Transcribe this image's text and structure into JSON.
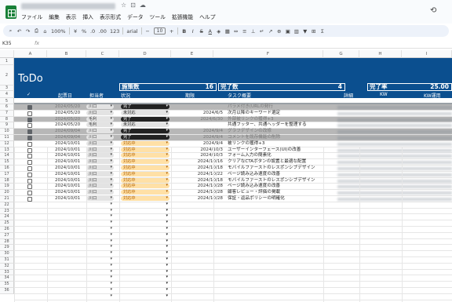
{
  "menu": [
    "ファイル",
    "編集",
    "表示",
    "挿入",
    "表示形式",
    "データ",
    "ツール",
    "拡張機能",
    "ヘルプ"
  ],
  "toolbar": {
    "zoom": "100%",
    "currency": "¥",
    "percent": "%",
    "dec_dec": ".0",
    "dec_inc": ".00",
    "number_format": "123",
    "font": "arial",
    "font_size": "10",
    "bold": "B",
    "italic": "I",
    "strike": "S",
    "text_color": "A"
  },
  "fxbar": {
    "cell_ref": "K35",
    "fx": "fx"
  },
  "columns": [
    "A",
    "B",
    "C",
    "D",
    "E",
    "F",
    "G",
    "H",
    "I"
  ],
  "rows": [
    "1",
    "2",
    "3",
    "4",
    "5",
    "6",
    "7",
    "8",
    "9",
    "10",
    "11",
    "12",
    "13",
    "14",
    "15",
    "16",
    "17",
    "18",
    "19",
    "20",
    "21",
    "22",
    "23",
    "24",
    "25",
    "26",
    "27",
    "28",
    "29",
    "30",
    "31",
    "32",
    "33",
    "34",
    "35",
    "36"
  ],
  "banner": {
    "title": "ToDo",
    "stats": [
      {
        "label": "施策数",
        "value": "16"
      },
      {
        "label": "完了数",
        "value": "4"
      },
      {
        "label": "完了率",
        "value": "25.00"
      }
    ]
  },
  "header": {
    "check": "✓",
    "date": "起票日",
    "person": "担当者",
    "status": "状況",
    "deadline": "期限",
    "summary": "タスク概要",
    "detail": "詳細",
    "kw": "KW",
    "kw_use": "KW運用"
  },
  "tasks": [
    {
      "checked": true,
      "date": "2024/05/20",
      "person": "川口",
      "status": "完了",
      "deadline": "",
      "summary": "パラメ付き(URLの発行"
    },
    {
      "checked": false,
      "date": "2024/05/20",
      "person": "川口",
      "status": "未対応",
      "deadline": "2024/6/5",
      "summary": "次月以降のキーワード選定"
    },
    {
      "checked": true,
      "date": "2024/05/20",
      "person": "毛利",
      "status": "完了",
      "deadline": "2024/6/30",
      "summary": "外部被リンクの獲得+3"
    },
    {
      "checked": false,
      "date": "2024/05/20",
      "person": "毛利",
      "status": "未対応",
      "deadline": "",
      "summary": "共通フッター、共通ヘッダーを整理する"
    },
    {
      "checked": true,
      "date": "2024/09/04",
      "person": "川口",
      "status": "完了",
      "deadline": "2024/9/4",
      "summary": "グラフデザインの改修"
    },
    {
      "checked": true,
      "date": "2024/09/04",
      "person": "川口",
      "status": "完了",
      "deadline": "2024/9/4",
      "summary": "コメントを既存機能の削除"
    },
    {
      "checked": false,
      "date": "2024/10/01",
      "person": "川口",
      "status": "対応中",
      "deadline": "2024/9/4",
      "summary": "被リンクの獲得+3"
    },
    {
      "checked": false,
      "date": "2024/10/01",
      "person": "川口",
      "status": "対応中",
      "deadline": "2024/10/3",
      "summary": "ユーザーインターフェース(UI)の改善"
    },
    {
      "checked": false,
      "date": "2024/10/01",
      "person": "川口",
      "status": "対応中",
      "deadline": "2024/10/3",
      "summary": "フォーム入力の簡素化"
    },
    {
      "checked": false,
      "date": "2024/10/01",
      "person": "川口",
      "status": "対応中",
      "deadline": "2024/10/16",
      "summary": "クリアなCTAボタンの設置と最適な配置"
    },
    {
      "checked": false,
      "date": "2024/10/01",
      "person": "川口",
      "status": "対応中",
      "deadline": "2024/10/18",
      "summary": "モバイルファーストのレスポンシブデザイン"
    },
    {
      "checked": false,
      "date": "2024/10/01",
      "person": "川口",
      "status": "対応中",
      "deadline": "2024/10/22",
      "summary": "ページ読み込み速度の改善"
    },
    {
      "checked": false,
      "date": "2024/10/01",
      "person": "川口",
      "status": "対応中",
      "deadline": "2024/10/18",
      "summary": "モバイルファーストのレスポンシブデザイン"
    },
    {
      "checked": false,
      "date": "2024/10/01",
      "person": "川口",
      "status": "対応中",
      "deadline": "2024/10/28",
      "summary": "ページ読み込み速度の改善"
    },
    {
      "checked": false,
      "date": "2024/10/01",
      "person": "川口",
      "status": "対応中",
      "deadline": "2024/10/28",
      "summary": "顧客レビュー・評価の掲載"
    },
    {
      "checked": false,
      "date": "2024/10/01",
      "person": "川口",
      "status": "対応中",
      "deadline": "2024/10/28",
      "summary": "保証・返品ポリシーの明確化"
    }
  ]
}
